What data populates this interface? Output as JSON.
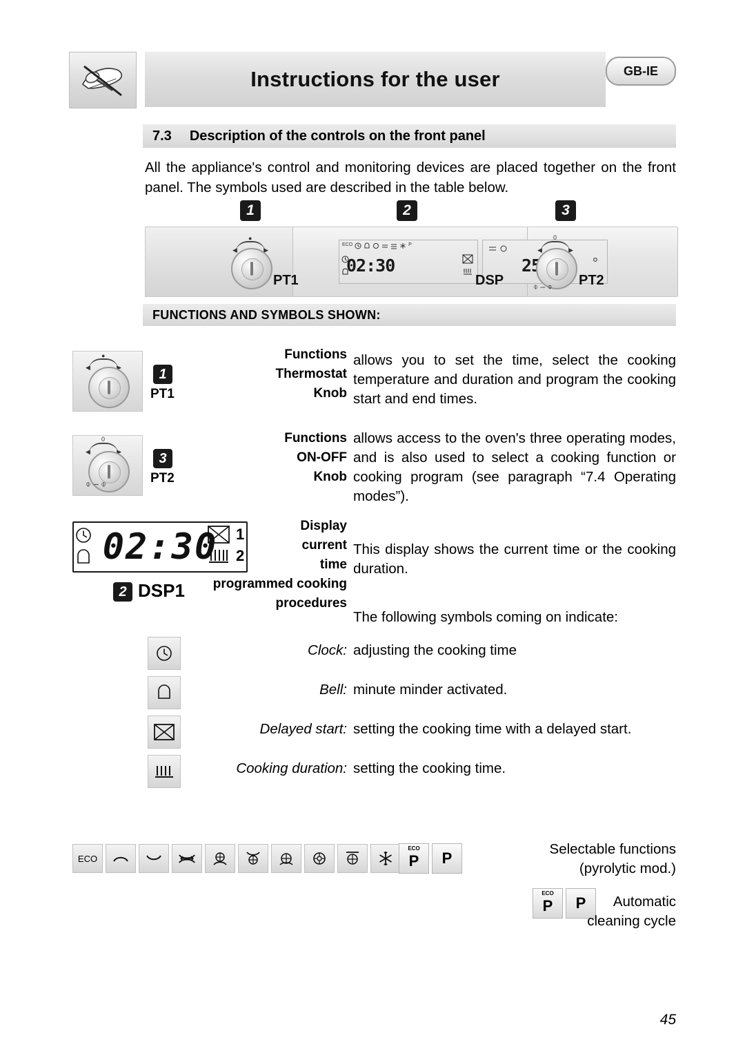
{
  "header": {
    "title": "Instructions for the user",
    "locale_badge": "GB-IE",
    "logo_icon": "spoon-crossed-out-icon"
  },
  "section": {
    "number": "7.3",
    "title": "Description of the controls on the front panel",
    "intro": "All the appliance's control and monitoring devices are placed together on the front panel. The symbols used are described in the table below."
  },
  "panel_diagram": {
    "callouts": [
      "1",
      "2",
      "3"
    ],
    "pt1_label": "PT1",
    "dsp_label": "DSP",
    "pt2_label": "PT2",
    "lcd_left_value": "02:30",
    "lcd_right_value": "250",
    "lcd_eco_tag": "ECO",
    "lcd_p_tag": "P",
    "knob_zero_tick": "0"
  },
  "functions_bar": {
    "title": "FUNCTIONS AND SYMBOLS SHOWN:"
  },
  "rows": [
    {
      "badge": "1",
      "device": "PT1",
      "label_lines": [
        "Functions",
        "Thermostat",
        "Knob"
      ],
      "text": "allows you to set the time, select the cooking temperature and duration and program the cooking start and end times."
    },
    {
      "badge": "3",
      "device": "PT2",
      "label_lines": [
        "Functions",
        "ON-OFF",
        "Knob"
      ],
      "text": "allows access to the oven's three operating modes, and is also used to select a cooking function or cooking program (see paragraph “7.4 Operating modes”)."
    },
    {
      "badge": "2",
      "device": "DSP1",
      "label_lines": [
        "Display",
        "current",
        "time",
        "programmed cooking",
        "procedures"
      ],
      "text": "This display shows the current time or the cooking duration."
    }
  ],
  "display_drawing": {
    "digits": "02:30",
    "clock_icon": "clock-icon",
    "bell_icon": "bell-icon",
    "delayed_start_icon": "delayed-start-icon",
    "cooking_duration_icon": "cooking-duration-icon",
    "marker_1": "1",
    "marker_2": "2",
    "badge": "2",
    "device": "DSP1"
  },
  "symbols_intro": "The following symbols coming on indicate:",
  "symbol_list": [
    {
      "icon": "clock-icon",
      "caption": "Clock:",
      "text": "adjusting the cooking time"
    },
    {
      "icon": "bell-icon",
      "caption": "Bell:",
      "text": "minute minder activated."
    },
    {
      "icon": "delayed-start-icon",
      "caption": "Delayed start:",
      "text": "setting the cooking time with a delayed start."
    },
    {
      "icon": "cooking-duration-icon",
      "caption": "Cooking duration:",
      "text": "setting the cooking time."
    }
  ],
  "function_strip": [
    {
      "icon": "eco-label",
      "label": "ECO"
    },
    {
      "icon": "lower-heating-element-icon",
      "label": ""
    },
    {
      "icon": "upper-heating-element-icon",
      "label": ""
    },
    {
      "icon": "upper-lower-heating-icon",
      "label": ""
    },
    {
      "icon": "fan-lower-heating-icon",
      "label": ""
    },
    {
      "icon": "fan-upper-heating-icon",
      "label": ""
    },
    {
      "icon": "fan-assisted-icon",
      "label": ""
    },
    {
      "icon": "circulaire-icon",
      "label": ""
    },
    {
      "icon": "grill-fan-icon",
      "label": ""
    },
    {
      "icon": "defrost-icon",
      "label": ""
    },
    {
      "icon": "pyrolytic-eco-icon",
      "label": "P"
    },
    {
      "icon": "pyrolytic-icon",
      "label": "P"
    }
  ],
  "right_notes": {
    "selectable_line1": "Selectable functions",
    "selectable_line2": "(pyrolytic mod.)",
    "auto_line1": "Automatic",
    "auto_line2": "cleaning cycle",
    "pyro_eco_label": "P",
    "pyro_eco_tag": "ECO",
    "pyro_label": "P"
  },
  "page_number": "45"
}
